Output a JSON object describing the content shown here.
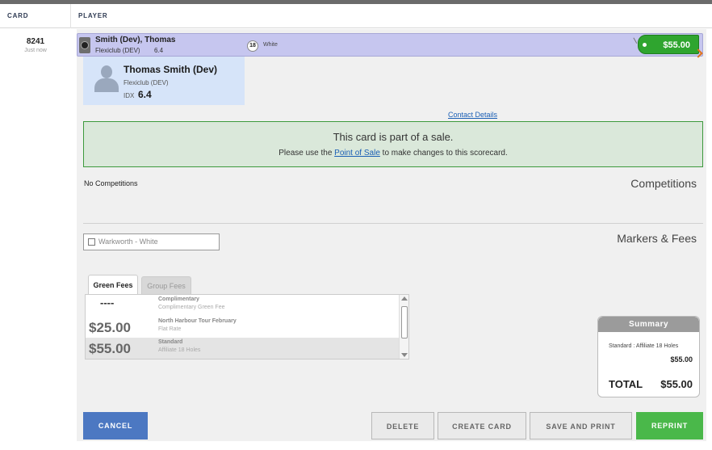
{
  "header": {
    "card_col": "CARD",
    "player_col": "PLAYER"
  },
  "card": {
    "number": "8241",
    "time": "Just now"
  },
  "player_row": {
    "name": "Smith (Dev), Thomas",
    "club": "Flexiclub (DEV)",
    "index": "6.4",
    "holes": "18",
    "tee": "White",
    "price": "$55.00",
    "price_color": "#2fa52f"
  },
  "player_card": {
    "name": "Thomas Smith (Dev)",
    "club": "Flexiclub (DEV)",
    "idx_label": "IDX",
    "idx_value": "6.4"
  },
  "contact_link": "Contact Details",
  "sale_notice": {
    "title": "This card is part of a sale.",
    "prefix": "Please use the ",
    "link": "Point of Sale",
    "suffix": " to make changes to this scorecard."
  },
  "competitions": {
    "empty_text": "No Competitions",
    "title": "Competitions"
  },
  "markers": {
    "title": "Markers & Fees",
    "marker_label": "Warkworth - White"
  },
  "fee_tabs": [
    {
      "label": "Green Fees",
      "active": true
    },
    {
      "label": "Group Fees",
      "active": false
    }
  ],
  "fees": [
    {
      "price": "----",
      "name": "Complimentary",
      "desc": "Complimentary Green Fee",
      "selected": false
    },
    {
      "price": "$25.00",
      "name": "North Harbour Tour February",
      "desc": "Flat Rate",
      "selected": false
    },
    {
      "price": "$55.00",
      "name": "Standard",
      "desc": "Affiliate 18 Holes",
      "selected": true
    }
  ],
  "summary": {
    "title": "Summary",
    "line": "Standard : Affiliate 18 Holes",
    "line_price": "$55.00",
    "total_label": "TOTAL",
    "total_value": "$55.00"
  },
  "buttons": {
    "cancel": "CANCEL",
    "delete": "DELETE",
    "create": "CREATE CARD",
    "save_print": "SAVE AND PRINT",
    "reprint": "REPRINT"
  }
}
